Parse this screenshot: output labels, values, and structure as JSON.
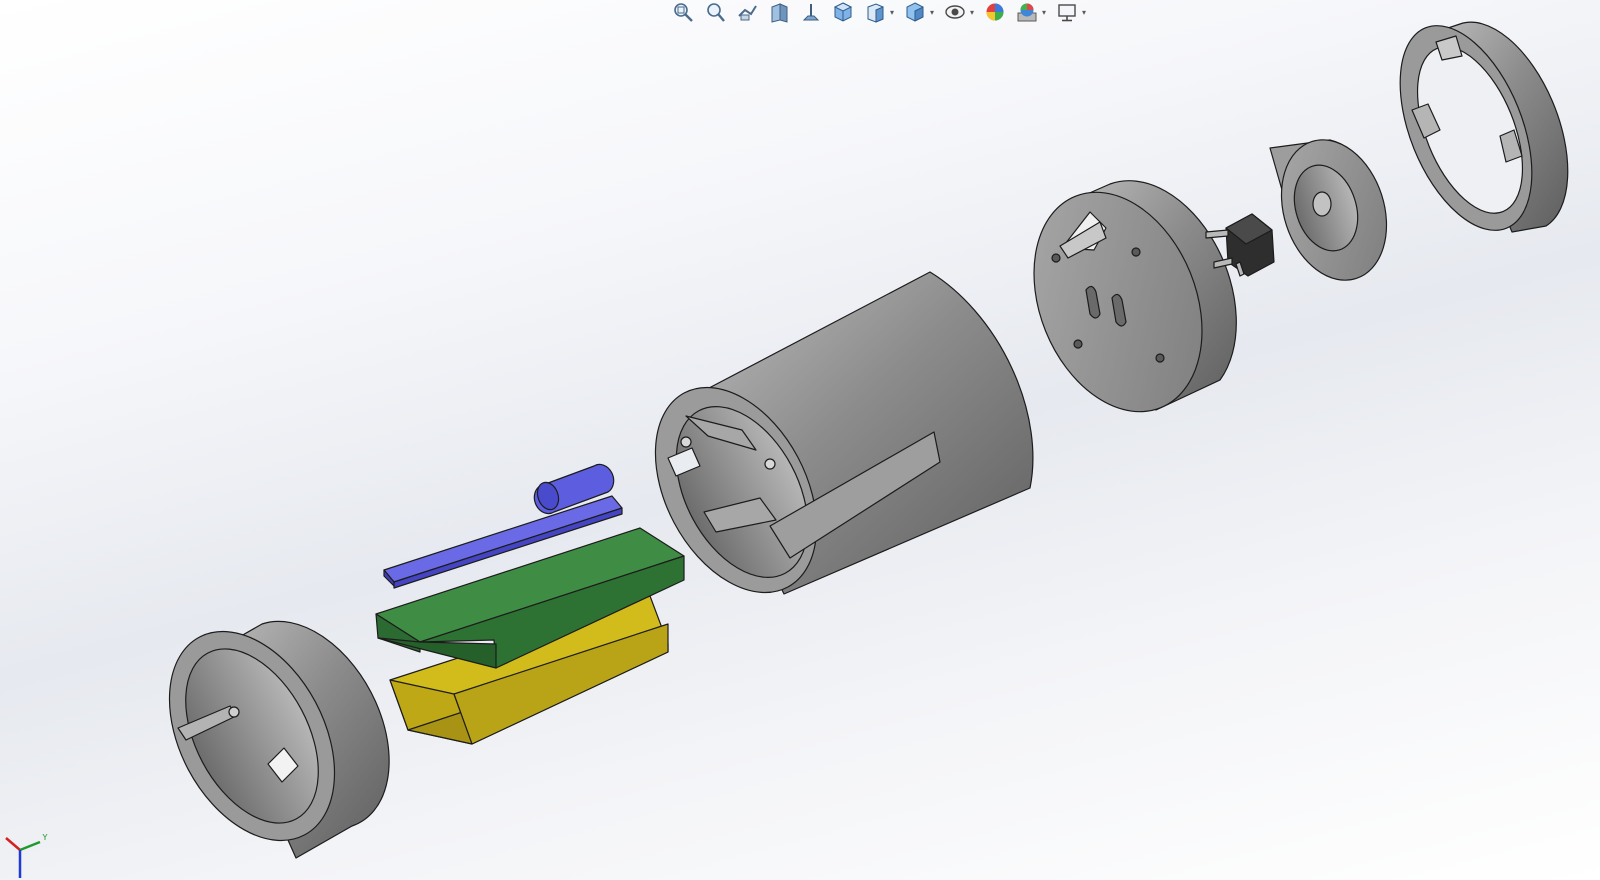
{
  "app": {
    "canvas_background": [
      "#ffffff",
      "#e6e9ef"
    ]
  },
  "toolbar": {
    "items": [
      {
        "icon": "zoom-to-fit-icon",
        "has_dropdown": false
      },
      {
        "icon": "zoom-to-area-icon",
        "has_dropdown": false
      },
      {
        "icon": "previous-view-icon",
        "has_dropdown": false
      },
      {
        "icon": "section-view-icon",
        "has_dropdown": false
      },
      {
        "icon": "dynamic-annotation-icon",
        "has_dropdown": false
      },
      {
        "icon": "3d-view-icon",
        "has_dropdown": false
      },
      {
        "icon": "view-orientation-icon",
        "has_dropdown": true
      },
      {
        "icon": "display-style-icon",
        "has_dropdown": true
      },
      {
        "icon": "hide-show-items-icon",
        "has_dropdown": true
      },
      {
        "icon": "edit-appearance-icon",
        "has_dropdown": false
      },
      {
        "icon": "apply-scene-icon",
        "has_dropdown": true
      },
      {
        "icon": "view-settings-icon",
        "has_dropdown": true
      }
    ]
  },
  "model": {
    "parts": [
      {
        "name": "end-cap-ring",
        "color": "#8f8f8f"
      },
      {
        "name": "battery",
        "color": "#c9b419"
      },
      {
        "name": "circuit-board",
        "color": "#2f7a37"
      },
      {
        "name": "blue-board",
        "color": "#5454d6"
      },
      {
        "name": "main-housing",
        "color": "#8f8f8f"
      },
      {
        "name": "end-plate",
        "color": "#8f8f8f"
      },
      {
        "name": "push-button-switch",
        "color": "#2e2e2e"
      },
      {
        "name": "button-cap",
        "color": "#8f8f8f"
      },
      {
        "name": "retaining-ring",
        "color": "#8f8f8f"
      }
    ],
    "edge_color": "#1c1c1c"
  },
  "triad": {
    "axis_y_label": "Y",
    "colors": {
      "x": "#d42020",
      "y": "#1f9a2e",
      "z": "#1f3ad4"
    }
  }
}
